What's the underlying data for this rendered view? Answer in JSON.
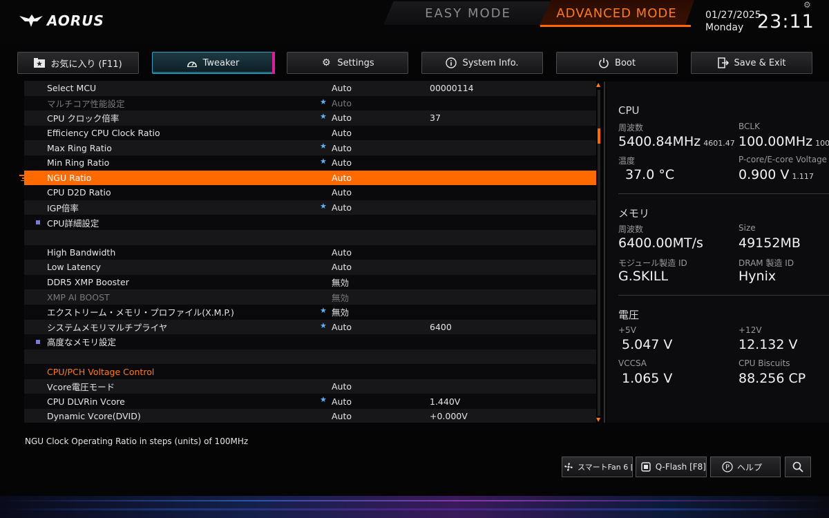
{
  "header": {
    "brand": "AORUS",
    "easy_mode": "EASY MODE",
    "advanced_mode": "ADVANCED MODE",
    "date": "01/27/2025",
    "weekday": "Monday",
    "time": "23:11"
  },
  "tabs": [
    {
      "label": "お気に入り (F11)",
      "icon": "star-folder-icon"
    },
    {
      "label": "Tweaker",
      "icon": "gauge-icon"
    },
    {
      "label": "Settings",
      "icon": "gear-icon"
    },
    {
      "label": "System Info.",
      "icon": "info-icon"
    },
    {
      "label": "Boot",
      "icon": "power-icon"
    },
    {
      "label": "Save & Exit",
      "icon": "exit-icon"
    }
  ],
  "rows": [
    {
      "label": "Select MCU",
      "value": "Auto",
      "value2": "00000114"
    },
    {
      "label": "マルチコア性能設定",
      "value": "Auto",
      "value2": ""
    },
    {
      "label": "CPU クロック倍率",
      "value": "Auto",
      "value2": "37"
    },
    {
      "label": "Efficiency CPU Clock Ratio",
      "value": "Auto",
      "value2": ""
    },
    {
      "label": "Max Ring Ratio",
      "value": "Auto",
      "value2": ""
    },
    {
      "label": "Min Ring Ratio",
      "value": "Auto",
      "value2": ""
    },
    {
      "label": "NGU Ratio",
      "value": "Auto",
      "value2": ""
    },
    {
      "label": "CPU D2D Ratio",
      "value": "Auto",
      "value2": ""
    },
    {
      "label": "IGP倍率",
      "value": "Auto",
      "value2": ""
    },
    {
      "label": "CPU詳細設定",
      "value": "",
      "value2": ""
    },
    {
      "label": "",
      "value": "",
      "value2": ""
    },
    {
      "label": "High Bandwidth",
      "value": "Auto",
      "value2": ""
    },
    {
      "label": "Low Latency",
      "value": "Auto",
      "value2": ""
    },
    {
      "label": "DDR5 XMP Booster",
      "value": "無効",
      "value2": ""
    },
    {
      "label": "XMP AI BOOST",
      "value": "無効",
      "value2": ""
    },
    {
      "label": "エクストリーム・メモリ・プロファイル(X.M.P.)",
      "value": "無効",
      "value2": ""
    },
    {
      "label": "システムメモリマルチプライヤ",
      "value": "Auto",
      "value2": "6400"
    },
    {
      "label": "高度なメモリ設定",
      "value": "",
      "value2": ""
    },
    {
      "label": "",
      "value": "",
      "value2": ""
    },
    {
      "label": "CPU/PCH Voltage Control",
      "value": "",
      "value2": ""
    },
    {
      "label": "Vcore電圧モード",
      "value": "Auto",
      "value2": ""
    },
    {
      "label": "CPU DLVRin Vcore",
      "value": "Auto",
      "value2": "1.440V"
    },
    {
      "label": "Dynamic Vcore(DVID)",
      "value": "Auto",
      "value2": "+0.000V"
    }
  ],
  "panel": {
    "cpu": {
      "title": "CPU",
      "freq_label": "周波数",
      "freq_value": "5400.84MHz",
      "freq_sub": "4601.47",
      "bclk_label": "BCLK",
      "bclk_value": "100.00MHz",
      "bclk_sub": "100.0",
      "temp_label": "温度",
      "temp_value": "37.0 °C",
      "volt_label": "P-core/E-core Voltage",
      "volt_value": "0.900 V",
      "volt_sub": "1.117"
    },
    "memory": {
      "title": "メモリ",
      "freq_label": "周波数",
      "freq_value": "6400.00MT/s",
      "size_label": "Size",
      "size_value": "49152MB",
      "module_label": "モジュール製造 ID",
      "module_value": "G.SKILL",
      "dram_label": "DRAM 製造 ID",
      "dram_value": "Hynix"
    },
    "voltage": {
      "title": "電圧",
      "v5_label": "+5V",
      "v5_value": "5.047 V",
      "v12_label": "+12V",
      "v12_value": "12.132 V",
      "vccsa_label": "VCCSA",
      "vccsa_value": "1.065 V",
      "biscuits_label": "CPU Biscuits",
      "biscuits_value": "88.256 CP"
    }
  },
  "help_text": "NGU Clock Operating Ratio in steps (units) of 100MHz",
  "footer": {
    "smart_fan": "スマートFan 6 [F",
    "qflash": "Q-Flash [F8]",
    "help": "ヘルプ"
  },
  "colors": {
    "accent": "#ff6a00",
    "tab_active": "#2aa3c0",
    "section": "#ff7a1a",
    "star": "#5bb4ff"
  }
}
